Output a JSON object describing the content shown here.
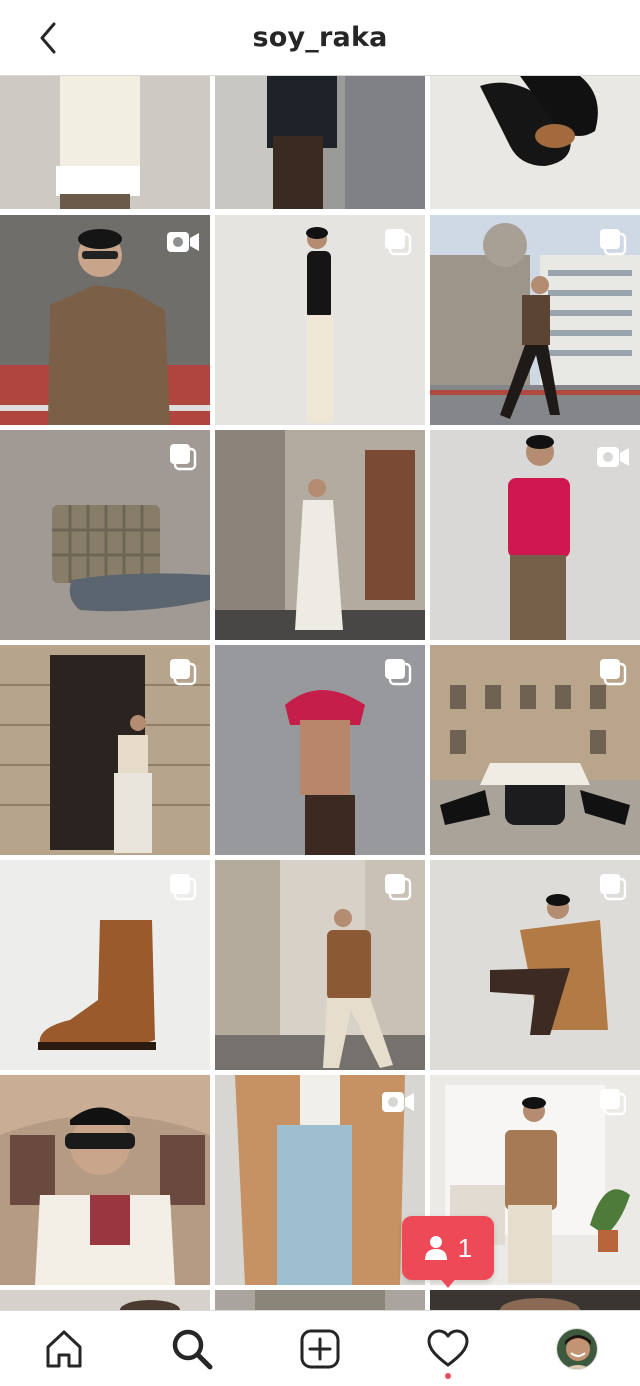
{
  "header": {
    "username": "soy_raka"
  },
  "grid": {
    "posts": [
      {
        "type": "single"
      },
      {
        "type": "single"
      },
      {
        "type": "single"
      },
      {
        "type": "video"
      },
      {
        "type": "carousel"
      },
      {
        "type": "carousel"
      },
      {
        "type": "carousel"
      },
      {
        "type": "single"
      },
      {
        "type": "video"
      },
      {
        "type": "carousel"
      },
      {
        "type": "carousel"
      },
      {
        "type": "carousel"
      },
      {
        "type": "carousel"
      },
      {
        "type": "carousel"
      },
      {
        "type": "carousel"
      },
      {
        "type": "single"
      },
      {
        "type": "video"
      },
      {
        "type": "carousel"
      }
    ]
  },
  "notification": {
    "count": "1",
    "icon": "person-icon"
  },
  "tabbar": {
    "items": [
      "home-icon",
      "search-icon",
      "new-post-icon",
      "activity-heart-icon",
      "profile-avatar"
    ],
    "active": "search-icon"
  },
  "colors": {
    "accent": "#ed4956",
    "text": "#262626",
    "divider": "#dbdbdb"
  }
}
